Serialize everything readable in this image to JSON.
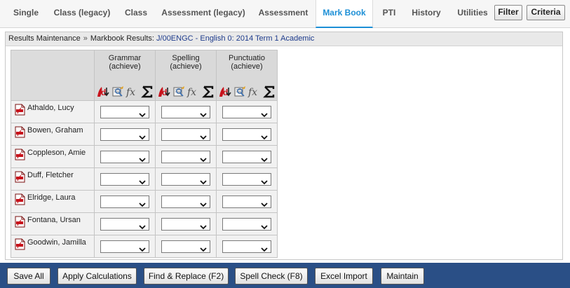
{
  "tabs": [
    {
      "label": "Single"
    },
    {
      "label": "Class (legacy)"
    },
    {
      "label": "Class"
    },
    {
      "label": "Assessment (legacy)"
    },
    {
      "label": "Assessment"
    },
    {
      "label": "Mark Book",
      "active": true
    },
    {
      "label": "PTI"
    },
    {
      "label": "History"
    },
    {
      "label": "Utilities"
    }
  ],
  "toolbar": {
    "filter_label": "Filter",
    "criteria_label": "Criteria"
  },
  "breadcrumb": {
    "root": "Results Maintenance",
    "separator": "»",
    "label": "Markbook Results:",
    "value": "J/00ENGC - English 0: 2014 Term 1 Academic"
  },
  "grid": {
    "columns": [
      {
        "name": "Grammar",
        "type": "(achieve)"
      },
      {
        "name": "Spelling",
        "type": "(achieve)"
      },
      {
        "name": "Punctuatio",
        "type": "(achieve)"
      }
    ],
    "column_icons": [
      "clear-icon",
      "edit-icon",
      "formula-icon",
      "sum-icon"
    ],
    "students": [
      {
        "name": "Athaldo, Lucy",
        "values": [
          "",
          "",
          ""
        ]
      },
      {
        "name": "Bowen, Graham",
        "values": [
          "",
          "",
          ""
        ]
      },
      {
        "name": "Coppleson, Amie",
        "values": [
          "",
          "",
          ""
        ]
      },
      {
        "name": "Duff, Fletcher",
        "values": [
          "",
          "",
          ""
        ]
      },
      {
        "name": "Elridge, Laura",
        "values": [
          "",
          "",
          ""
        ]
      },
      {
        "name": "Fontana, Ursan",
        "values": [
          "",
          "",
          ""
        ]
      },
      {
        "name": "Goodwin, Jamilla",
        "values": [
          "",
          "",
          ""
        ]
      }
    ]
  },
  "actions": [
    {
      "label": "Save All"
    },
    {
      "label": "Apply Calculations"
    },
    {
      "label": "Find & Replace (F2)"
    },
    {
      "label": "Spell Check (F8)"
    },
    {
      "label": "Excel Import"
    },
    {
      "label": "Maintain"
    }
  ],
  "colors": {
    "accent": "#1c8fd6",
    "bottom_bar": "#2a4f86",
    "breadcrumb_value": "#1d3b8c"
  }
}
